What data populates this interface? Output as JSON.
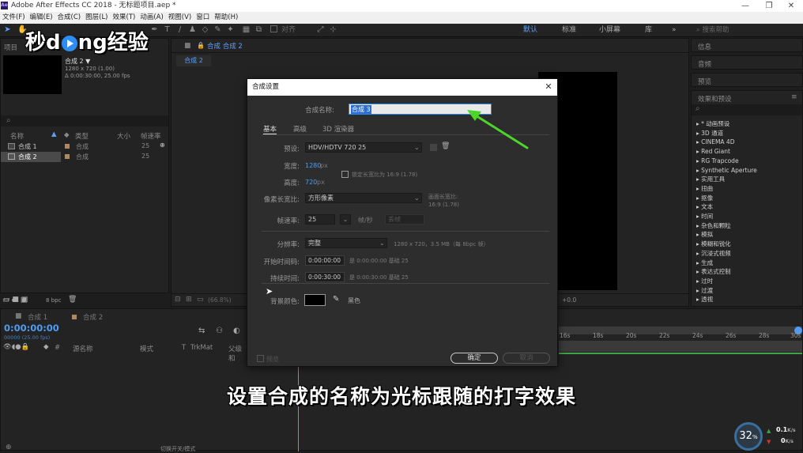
{
  "window": {
    "title": "Adobe After Effects CC 2018 - 无标题项目.aep *",
    "logo": "Ae",
    "min": "—",
    "max": "❐",
    "close": "✕"
  },
  "menu": [
    "文件(F)",
    "编辑(E)",
    "合成(C)",
    "图层(L)",
    "效果(T)",
    "动画(A)",
    "视图(V)",
    "窗口",
    "帮助(H)"
  ],
  "toolbar": {
    "align_label": "对齐",
    "workspaces": [
      "默认",
      "标准",
      "小屏幕",
      "库"
    ],
    "more": "»",
    "search_placeholder": "搜索帮助"
  },
  "watermark": {
    "part1": "秒",
    "part2": "d",
    "part3": "ng经验"
  },
  "project": {
    "tab": "项目",
    "comp_name": "合成 2 ▼",
    "comp_info1": "1280 x 720 (1.00)",
    "comp_info2": "Δ 0:00:30:00, 25.00 fps",
    "search_icon": "⌕",
    "columns": {
      "name": "名称",
      "type": "类型",
      "size": "大小",
      "fps": "帧速率"
    },
    "rows": [
      {
        "name": "合成 1",
        "type": "合成",
        "fps": "25"
      },
      {
        "name": "合成 2",
        "type": "合成",
        "fps": "25"
      }
    ],
    "bpc": "8 bpc"
  },
  "composition": {
    "tab": "合成 合成 2",
    "subtab": "合成 2",
    "zoom": "(66.8%)",
    "offset": "+0.0"
  },
  "right_panels": [
    "信息",
    "音频",
    "预览",
    "效果和预设"
  ],
  "effects": [
    "▸ * 动画预设",
    "▸ 3D 通道",
    "▸ CINEMA 4D",
    "▸ Red Giant",
    "▸ RG Trapcode",
    "▸ Synthetic Aperture",
    "▸ 实用工具",
    "▸ 扭曲",
    "▸ 抠像",
    "▸ 文本",
    "▸ 时间",
    "▸ 杂色和颗粒",
    "▸ 模拟",
    "▸ 模糊和锐化",
    "▸ 沉浸式视频",
    "▸ 生成",
    "▸ 表达式控制",
    "▸ 过时",
    "▸ 过渡",
    "▸ 透视"
  ],
  "timeline": {
    "tabs": [
      "合成 1",
      "合成 2"
    ],
    "timecode": "0:00:00:00",
    "timecode_sub": "00000 (25.00 fps)",
    "cols": {
      "source": "源名称",
      "mode": "模式",
      "t": "T",
      "trkmat": "TrkMat",
      "parent": "父级和"
    },
    "ruler": [
      "16s",
      "18s",
      "20s",
      "22s",
      "24s",
      "26s",
      "28s",
      "30s"
    ],
    "bottom": "切换开关/模式"
  },
  "dialog": {
    "title": "合成设置",
    "name_label": "合成名称:",
    "name_value": "合成 3",
    "tabs": [
      "基本",
      "高级",
      "3D 渲染器"
    ],
    "preset_label": "预设:",
    "preset_value": "HDV/HDTV 720 25",
    "width_label": "宽度:",
    "width_value": "1280",
    "px": "px",
    "lock_label": "锁定长宽比为 16:9 (1.78)",
    "height_label": "高度:",
    "height_value": "720",
    "par_label": "像素长宽比:",
    "par_value": "方形像素",
    "frame_ar_label": "画面长宽比:",
    "frame_ar_value": "16:9 (1.78)",
    "fps_label": "帧速率:",
    "fps_value": "25",
    "fps_unit": "帧/秒",
    "fps_drop": "丢帧",
    "res_label": "分辨率:",
    "res_value": "完整",
    "res_info": "1280 x 720，3.5 MB（每 8bpc 帧）",
    "start_label": "开始时间码:",
    "start_value": "0:00:00:00",
    "start_info": "是 0:00:00:00 基础 25",
    "dur_label": "持续时间:",
    "dur_value": "0:00:30:00",
    "dur_info": "是 0:00:30:00 基础 25",
    "bg_label": "背景颜色:",
    "bg_color_name": "黑色",
    "preview_label": "预览",
    "ok": "确定",
    "cancel": "取消"
  },
  "caption": "设置合成的名称为光标跟随的打字效果",
  "netmon": {
    "percent": "32",
    "pct_sign": "%",
    "up": "0.1",
    "up_unit": "K/s",
    "down": "0",
    "down_unit": "K/s"
  },
  "colors": {
    "accent": "#2d8ceb",
    "arrow": "#4cd62a",
    "workspace_active": "#5aa0ff"
  }
}
